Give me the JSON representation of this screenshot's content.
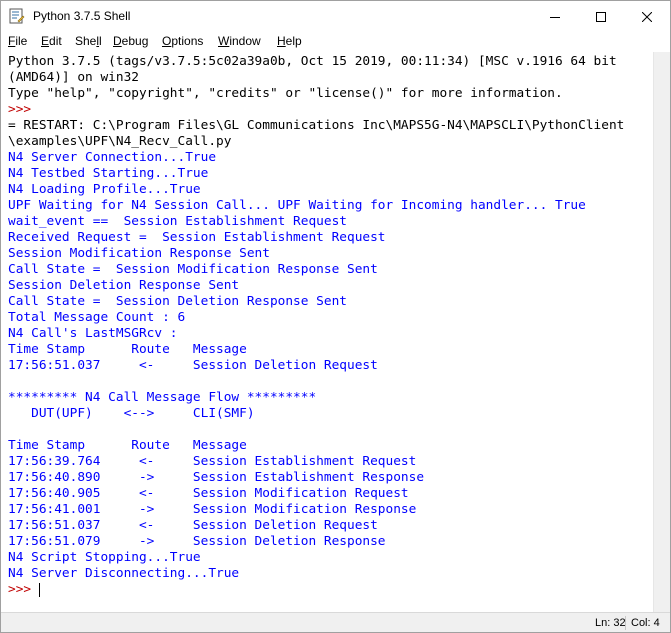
{
  "window": {
    "title": "Python 3.7.5 Shell"
  },
  "menu": {
    "items": [
      {
        "label": "File",
        "u": "F",
        "rest": "ile"
      },
      {
        "label": "Edit",
        "u": "E",
        "rest": "dit"
      },
      {
        "label": "Shell",
        "pre": "She",
        "u": "l",
        "rest": "l"
      },
      {
        "label": "Debug",
        "u": "D",
        "rest": "ebug"
      },
      {
        "label": "Options",
        "u": "O",
        "rest": "ptions"
      },
      {
        "label": "Window",
        "u": "W",
        "rest": "indow"
      },
      {
        "label": "Help",
        "u": "H",
        "rest": "elp"
      }
    ]
  },
  "shell": {
    "lines": [
      {
        "text": "Python 3.7.5 (tags/v3.7.5:5c02a39a0b, Oct 15 2019, 00:11:34) [MSC v.1916 64 bit",
        "color": "black"
      },
      {
        "text": "(AMD64)] on win32",
        "color": "black"
      },
      {
        "text": "Type \"help\", \"copyright\", \"credits\" or \"license()\" for more information.",
        "color": "black"
      },
      {
        "text": ">>> ",
        "color": "red"
      },
      {
        "text": "= RESTART: C:\\Program Files\\GL Communications Inc\\MAPS5G-N4\\MAPSCLI\\PythonClient",
        "color": "black"
      },
      {
        "text": "\\examples\\UPF\\N4_Recv_Call.py",
        "color": "black"
      },
      {
        "text": "N4 Server Connection...True",
        "color": "blue"
      },
      {
        "text": "N4 Testbed Starting...True",
        "color": "blue"
      },
      {
        "text": "N4 Loading Profile...True",
        "color": "blue"
      },
      {
        "text": "UPF Waiting for N4 Session Call... UPF Waiting for Incoming handler... True",
        "color": "blue"
      },
      {
        "text": "wait_event ==  Session Establishment Request",
        "color": "blue"
      },
      {
        "text": "Received Request =  Session Establishment Request",
        "color": "blue"
      },
      {
        "text": "Session Modification Response Sent",
        "color": "blue"
      },
      {
        "text": "Call State =  Session Modification Response Sent",
        "color": "blue"
      },
      {
        "text": "Session Deletion Response Sent",
        "color": "blue"
      },
      {
        "text": "Call State =  Session Deletion Response Sent",
        "color": "blue"
      },
      {
        "text": "Total Message Count : 6",
        "color": "blue"
      },
      {
        "text": "N4 Call's LastMSGRcv :",
        "color": "blue"
      },
      {
        "text": "Time Stamp      Route   Message",
        "color": "blue"
      },
      {
        "text": "17:56:51.037     <-     Session Deletion Request",
        "color": "blue"
      },
      {
        "text": "",
        "color": "blue"
      },
      {
        "text": "********* N4 Call Message Flow *********",
        "color": "blue"
      },
      {
        "text": "   DUT(UPF)    <-->     CLI(SMF)",
        "color": "blue"
      },
      {
        "text": "",
        "color": "blue"
      },
      {
        "text": "Time Stamp      Route   Message",
        "color": "blue"
      },
      {
        "text": "17:56:39.764     <-     Session Establishment Request",
        "color": "blue"
      },
      {
        "text": "17:56:40.890     ->     Session Establishment Response",
        "color": "blue"
      },
      {
        "text": "17:56:40.905     <-     Session Modification Request",
        "color": "blue"
      },
      {
        "text": "17:56:41.001     ->     Session Modification Response",
        "color": "blue"
      },
      {
        "text": "17:56:51.037     <-     Session Deletion Request",
        "color": "blue"
      },
      {
        "text": "17:56:51.079     ->     Session Deletion Response",
        "color": "blue"
      },
      {
        "text": "N4 Script Stopping...True",
        "color": "blue"
      },
      {
        "text": "N4 Server Disconnecting...True",
        "color": "blue"
      },
      {
        "text": ">>> ",
        "color": "red"
      }
    ]
  },
  "status": {
    "line": "Ln: 32",
    "col": "Col: 4"
  },
  "colors": {
    "prompt": "#c00000",
    "stdout": "#0000ff",
    "text": "#000000"
  }
}
